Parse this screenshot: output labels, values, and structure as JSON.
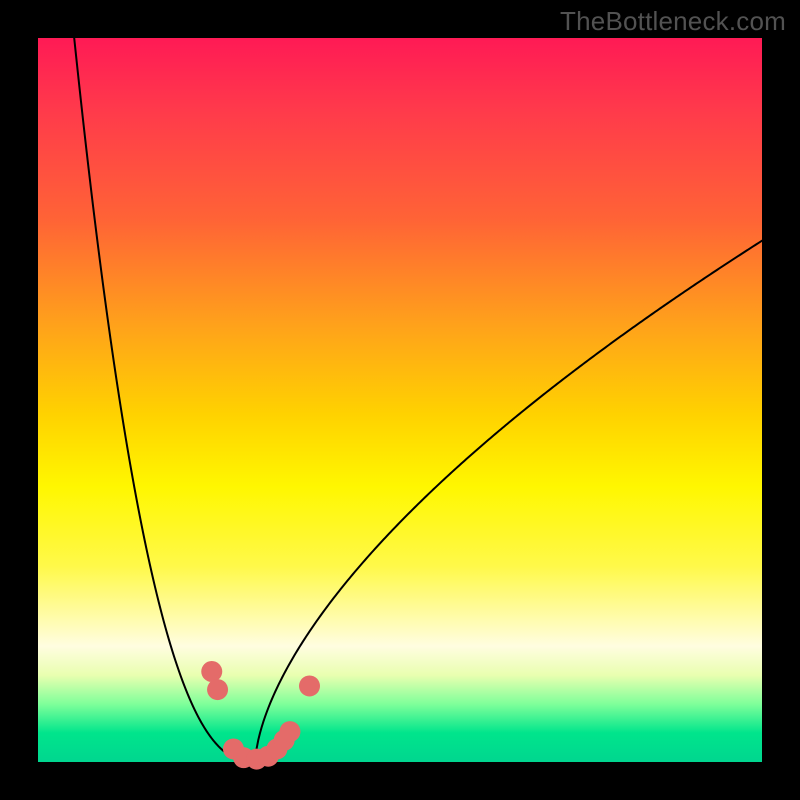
{
  "watermark": "TheBottleneck.com",
  "colors": {
    "background": "#000000",
    "curve": "#000000",
    "marker": "#e46b69",
    "gradient_stops": [
      {
        "pos": 0.0,
        "hex": "#ff1a55"
      },
      {
        "pos": 0.1,
        "hex": "#ff3a4b"
      },
      {
        "pos": 0.25,
        "hex": "#ff6336"
      },
      {
        "pos": 0.4,
        "hex": "#ffa31a"
      },
      {
        "pos": 0.52,
        "hex": "#ffd200"
      },
      {
        "pos": 0.62,
        "hex": "#fff700"
      },
      {
        "pos": 0.73,
        "hex": "#fff94a"
      },
      {
        "pos": 0.84,
        "hex": "#fffde0"
      },
      {
        "pos": 0.88,
        "hex": "#e9ffb0"
      },
      {
        "pos": 0.92,
        "hex": "#7fff9a"
      },
      {
        "pos": 0.96,
        "hex": "#00e58c"
      },
      {
        "pos": 1.0,
        "hex": "#00d68f"
      }
    ]
  },
  "chart_data": {
    "type": "line",
    "title": "",
    "xlabel": "",
    "ylabel": "",
    "x_range": [
      0,
      100
    ],
    "y_range": [
      0,
      100
    ],
    "curve": {
      "description": "Bottleneck percentage vs component balance; reaches 0 near x≈30 and rises on both sides",
      "minimum_x": 30,
      "left_top_x": 5,
      "right_top_x": 100,
      "left_top_y": 100,
      "right_top_y": 72,
      "shape_exponent_left": 2.4,
      "shape_exponent_right": 0.62
    },
    "markers": [
      {
        "x": 24.0,
        "y": 12.5
      },
      {
        "x": 24.8,
        "y": 10.0
      },
      {
        "x": 27.0,
        "y": 1.8
      },
      {
        "x": 28.4,
        "y": 0.6
      },
      {
        "x": 30.2,
        "y": 0.4
      },
      {
        "x": 31.8,
        "y": 0.8
      },
      {
        "x": 33.0,
        "y": 1.8
      },
      {
        "x": 34.0,
        "y": 3.0
      },
      {
        "x": 34.8,
        "y": 4.2
      },
      {
        "x": 37.5,
        "y": 10.5
      }
    ]
  }
}
